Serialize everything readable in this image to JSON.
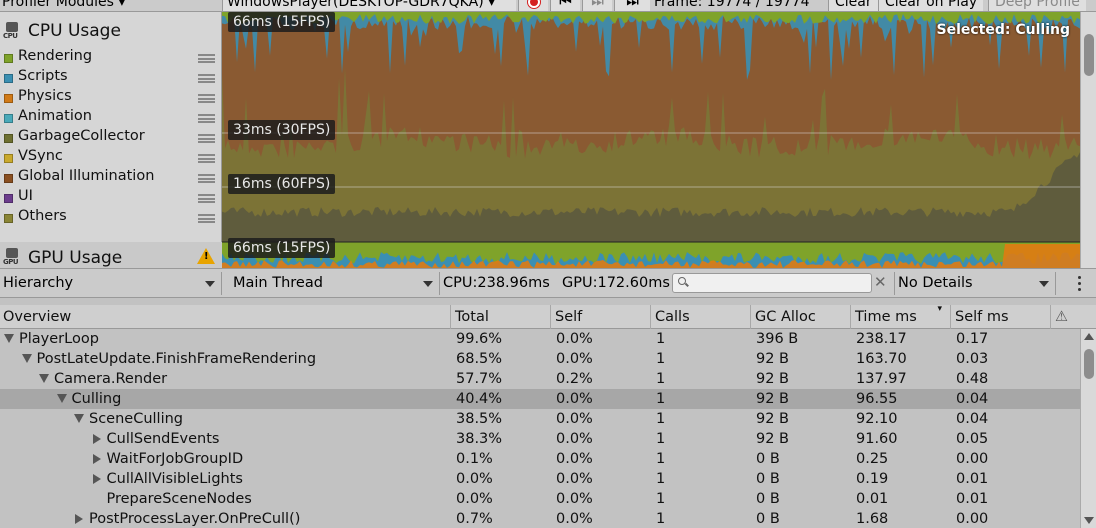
{
  "toolbar": {
    "modules_label": "Profiler Modules",
    "target_label": "WindowsPlayer(DESKTOP-GDR7QKA)",
    "frame_label": "Frame: 19774 / 19774",
    "clear_label": "Clear",
    "clear_on_play_label": "Clear on Play",
    "deep_profile_label": "Deep Profile"
  },
  "cpu_module": {
    "icon_label": "CPU",
    "title": "CPU Usage",
    "items": [
      {
        "name": "Rendering",
        "color": "#7fa32a"
      },
      {
        "name": "Scripts",
        "color": "#3a8fb2"
      },
      {
        "name": "Physics",
        "color": "#d17a17"
      },
      {
        "name": "Animation",
        "color": "#49a9b9"
      },
      {
        "name": "GarbageCollector",
        "color": "#6e7031"
      },
      {
        "name": "VSync",
        "color": "#c9a92d"
      },
      {
        "name": "Global Illumination",
        "color": "#8a4f20"
      },
      {
        "name": "UI",
        "color": "#6b3c8c"
      },
      {
        "name": "Others",
        "color": "#8a8535"
      }
    ]
  },
  "gpu_module": {
    "icon_label": "GPU",
    "title": "GPU Usage"
  },
  "chart": {
    "labels": [
      "66ms (15FPS)",
      "33ms (30FPS)",
      "16ms (60FPS)",
      "66ms (15FPS)"
    ],
    "selected_text": "Selected: Culling",
    "colors": {
      "brown": "#8a5a32",
      "olive": "#7b7537",
      "blue": "#3a8fb2",
      "green": "#7fa32a",
      "orange": "#e07b12",
      "dark": "#5c5a3e"
    }
  },
  "hierarchy_bar": {
    "view_mode": "Hierarchy",
    "thread": "Main Thread",
    "cpu_time": "CPU:238.96ms",
    "gpu_time": "GPU:172.60ms",
    "search_placeholder": "",
    "details": "No Details"
  },
  "table": {
    "columns": [
      "Overview",
      "Total",
      "Self",
      "Calls",
      "GC Alloc",
      "Time ms",
      "Self ms",
      "⚠"
    ],
    "rows": [
      {
        "depth": 0,
        "expand": "down",
        "name": "PlayerLoop",
        "total": "99.6%",
        "self": "0.0%",
        "calls": "1",
        "gc": "396 B",
        "time": "238.17",
        "selfms": "0.17",
        "selected": false
      },
      {
        "depth": 1,
        "expand": "down",
        "name": "PostLateUpdate.FinishFrameRendering",
        "total": "68.5%",
        "self": "0.0%",
        "calls": "1",
        "gc": "92 B",
        "time": "163.70",
        "selfms": "0.03",
        "selected": false
      },
      {
        "depth": 2,
        "expand": "down",
        "name": "Camera.Render",
        "total": "57.7%",
        "self": "0.2%",
        "calls": "1",
        "gc": "92 B",
        "time": "137.97",
        "selfms": "0.48",
        "selected": false
      },
      {
        "depth": 3,
        "expand": "down",
        "name": "Culling",
        "total": "40.4%",
        "self": "0.0%",
        "calls": "1",
        "gc": "92 B",
        "time": "96.55",
        "selfms": "0.04",
        "selected": true
      },
      {
        "depth": 4,
        "expand": "down",
        "name": "SceneCulling",
        "total": "38.5%",
        "self": "0.0%",
        "calls": "1",
        "gc": "92 B",
        "time": "92.10",
        "selfms": "0.04",
        "selected": false
      },
      {
        "depth": 5,
        "expand": "right",
        "name": "CullSendEvents",
        "total": "38.3%",
        "self": "0.0%",
        "calls": "1",
        "gc": "92 B",
        "time": "91.60",
        "selfms": "0.05",
        "selected": false
      },
      {
        "depth": 5,
        "expand": "right",
        "name": "WaitForJobGroupID",
        "total": "0.1%",
        "self": "0.0%",
        "calls": "1",
        "gc": "0 B",
        "time": "0.25",
        "selfms": "0.00",
        "selected": false
      },
      {
        "depth": 5,
        "expand": "right",
        "name": "CullAllVisibleLights",
        "total": "0.0%",
        "self": "0.0%",
        "calls": "1",
        "gc": "0 B",
        "time": "0.19",
        "selfms": "0.01",
        "selected": false
      },
      {
        "depth": 5,
        "expand": "none",
        "name": "PrepareSceneNodes",
        "total": "0.0%",
        "self": "0.0%",
        "calls": "1",
        "gc": "0 B",
        "time": "0.01",
        "selfms": "0.01",
        "selected": false
      },
      {
        "depth": 4,
        "expand": "right",
        "name": "PostProcessLayer.OnPreCull()",
        "total": "0.7%",
        "self": "0.0%",
        "calls": "1",
        "gc": "0 B",
        "time": "1.68",
        "selfms": "0.00",
        "selected": false
      }
    ]
  }
}
